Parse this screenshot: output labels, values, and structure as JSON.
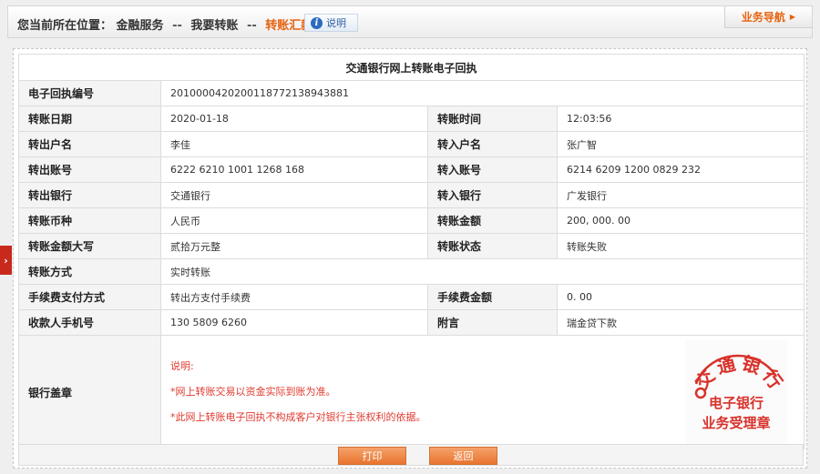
{
  "breadcrumb": {
    "prefix": "您当前所在位置：",
    "item1": "金融服务",
    "sep": "--",
    "item2": "我要转账",
    "current": "转账汇款"
  },
  "help_label": "说明",
  "nav_label": "业务导航",
  "receipt": {
    "title": "交通银行网上转账电子回执",
    "receipt_no_label": "电子回执编号",
    "receipt_no": "2010000420200118772138943881",
    "rows": [
      {
        "l1": "转账日期",
        "v1": "2020-01-18",
        "l2": "转账时间",
        "v2": "12:03:56"
      },
      {
        "l1": "转出户名",
        "v1": "李佳",
        "l2": "转入户名",
        "v2": "张广智"
      },
      {
        "l1": "转出账号",
        "v1": "6222 6210 1001 1268 168",
        "l2": "转入账号",
        "v2": "6214 6209 1200 0829 232"
      },
      {
        "l1": "转出银行",
        "v1": "交通银行",
        "l2": "转入银行",
        "v2": "广发银行"
      },
      {
        "l1": "转账币种",
        "v1": "人民币",
        "l2": "转账金额",
        "v2": "200, 000. 00"
      },
      {
        "l1": "转账金额大写",
        "v1": "贰拾万元整",
        "l2": "转账状态",
        "v2": "转账失败"
      }
    ],
    "method_label": "转账方式",
    "method": "实时转账",
    "fee_method_label": "手续费支付方式",
    "fee_method": "转出方支付手续费",
    "fee_amount_label": "手续费金额",
    "fee_amount": "0. 00",
    "phone_label": "收款人手机号",
    "phone": "130 5809 6260",
    "memo_label": "附言",
    "memo": "瑞金贷下款",
    "seal_label": "银行盖章",
    "notes": {
      "title": "说明:",
      "line1": "*网上转账交易以资金实际到账为准。",
      "line2": "*此网上转账电子回执不构成客户对银行主张权利的依据。"
    },
    "stamp": {
      "ring_text": "交通银行",
      "line1": "电子银行",
      "line2": "业务受理章"
    }
  },
  "buttons": {
    "print": "打印",
    "back": "返回"
  },
  "side_tab": "›",
  "colors": {
    "accent": "#e7620f",
    "note_red": "#e03a2f",
    "stamp_red": "#d8312a"
  }
}
